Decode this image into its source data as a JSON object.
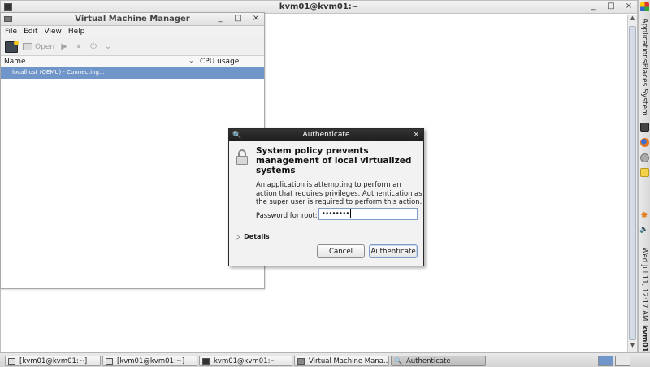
{
  "terminal": {
    "title": "kvm01@kvm01:~",
    "btn_min": "_",
    "btn_max": "□",
    "btn_close": "×",
    "scroll_up": "▲",
    "scroll_down": "▼"
  },
  "vmm": {
    "title": "Virtual Machine Manager",
    "btn_min": "_",
    "btn_max": "□",
    "btn_close": "×",
    "menu": {
      "file": "File",
      "edit": "Edit",
      "view": "View",
      "help": "Help"
    },
    "toolbar": {
      "open": "Open",
      "run": "▶",
      "pause": "⏸",
      "shutdown": "⏻",
      "more": "⌄"
    },
    "columns": {
      "name": "Name",
      "sort": "⌄",
      "cpu": "CPU usage"
    },
    "rows": [
      {
        "label": "localhost (QEMU) - Connecting..."
      }
    ]
  },
  "auth": {
    "title": "Authenticate",
    "key_glyph": "🔍",
    "close": "×",
    "heading": "System policy prevents management of local virtualized systems",
    "description": "An application is attempting to perform an action that requires privileges. Authentication as the super user is required to perform this action.",
    "password_label": "Password for root:",
    "password_value": "••••••••",
    "details": "Details",
    "details_arrow": "▷",
    "cancel": "Cancel",
    "authenticate": "Authenticate"
  },
  "panel": {
    "applications": "Applications",
    "places": "Places",
    "system": "System",
    "clock": "Wed Jul 11, 12:17 AM",
    "host": "kvm01",
    "speaker": "🔈",
    "notify": "✸"
  },
  "taskbar": {
    "items": [
      {
        "label": "[kvm01@kvm01:~]"
      },
      {
        "label": "[kvm01@kvm01:~]"
      },
      {
        "label": "kvm01@kvm01:~"
      },
      {
        "label": "Virtual Machine Mana..."
      },
      {
        "label": "Authenticate"
      }
    ]
  }
}
